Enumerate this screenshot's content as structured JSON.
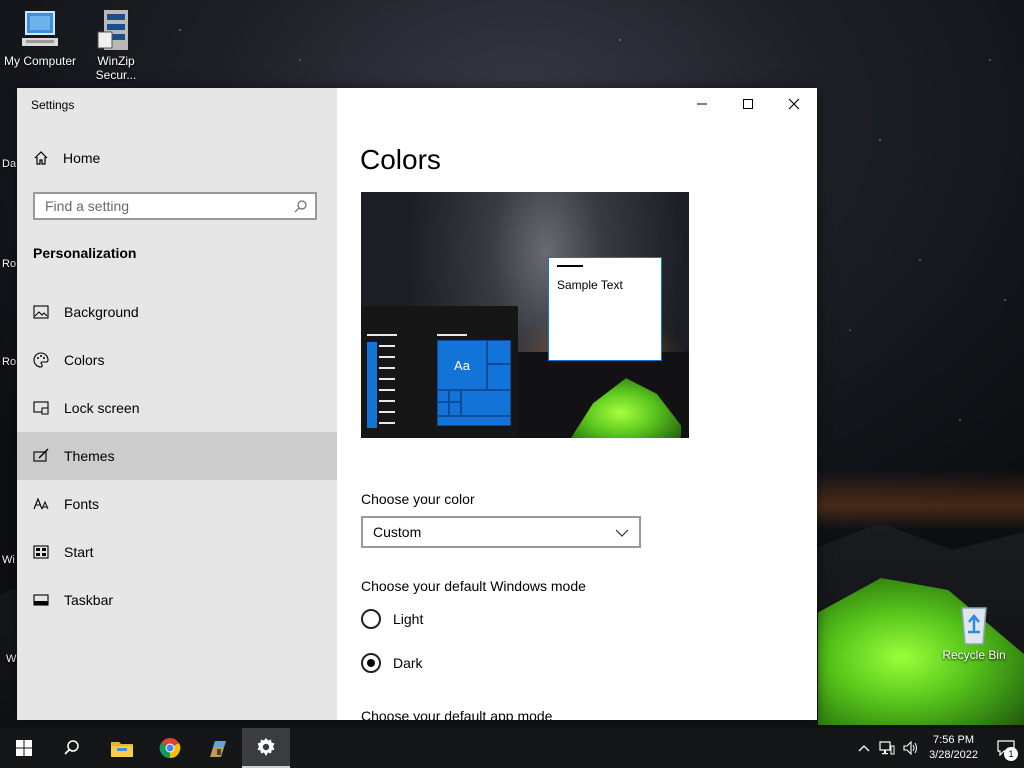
{
  "desktop": {
    "icons": [
      {
        "label": "My Computer"
      },
      {
        "label": "WinZip Secur..."
      },
      {
        "label": "Recycle Bin"
      }
    ],
    "edge_labels": [
      "Da",
      "Ro",
      "Ro",
      "Wi",
      "W"
    ]
  },
  "window": {
    "title": "Settings",
    "controls": [
      "minimize-icon",
      "maximize-icon",
      "close-icon"
    ]
  },
  "sidebar": {
    "home_label": "Home",
    "search_placeholder": "Find a setting",
    "section_title": "Personalization",
    "items": [
      {
        "label": "Background",
        "icon": "image-icon"
      },
      {
        "label": "Colors",
        "icon": "palette-icon"
      },
      {
        "label": "Lock screen",
        "icon": "lock-screen-icon"
      },
      {
        "label": "Themes",
        "icon": "themes-icon",
        "active": true
      },
      {
        "label": "Fonts",
        "icon": "fonts-icon"
      },
      {
        "label": "Start",
        "icon": "start-icon"
      },
      {
        "label": "Taskbar",
        "icon": "taskbar-icon"
      }
    ]
  },
  "main": {
    "heading": "Colors",
    "preview": {
      "sample_text": "Sample Text",
      "tile_label": "Aa",
      "accent": "#1273d8"
    },
    "choose_color_label": "Choose your color",
    "color_dropdown_value": "Custom",
    "windows_mode_label": "Choose your default Windows mode",
    "windows_mode_options": [
      {
        "label": "Light",
        "checked": false
      },
      {
        "label": "Dark",
        "checked": true
      }
    ],
    "app_mode_label": "Choose your default app mode"
  },
  "taskbar": {
    "apps": [
      "start-icon",
      "search-icon",
      "file-explorer-icon",
      "chrome-icon",
      "winzip-icon",
      "settings-icon"
    ],
    "active_app": "settings-icon",
    "time": "7:56 PM",
    "date": "3/28/2022",
    "notification_count": "1"
  }
}
